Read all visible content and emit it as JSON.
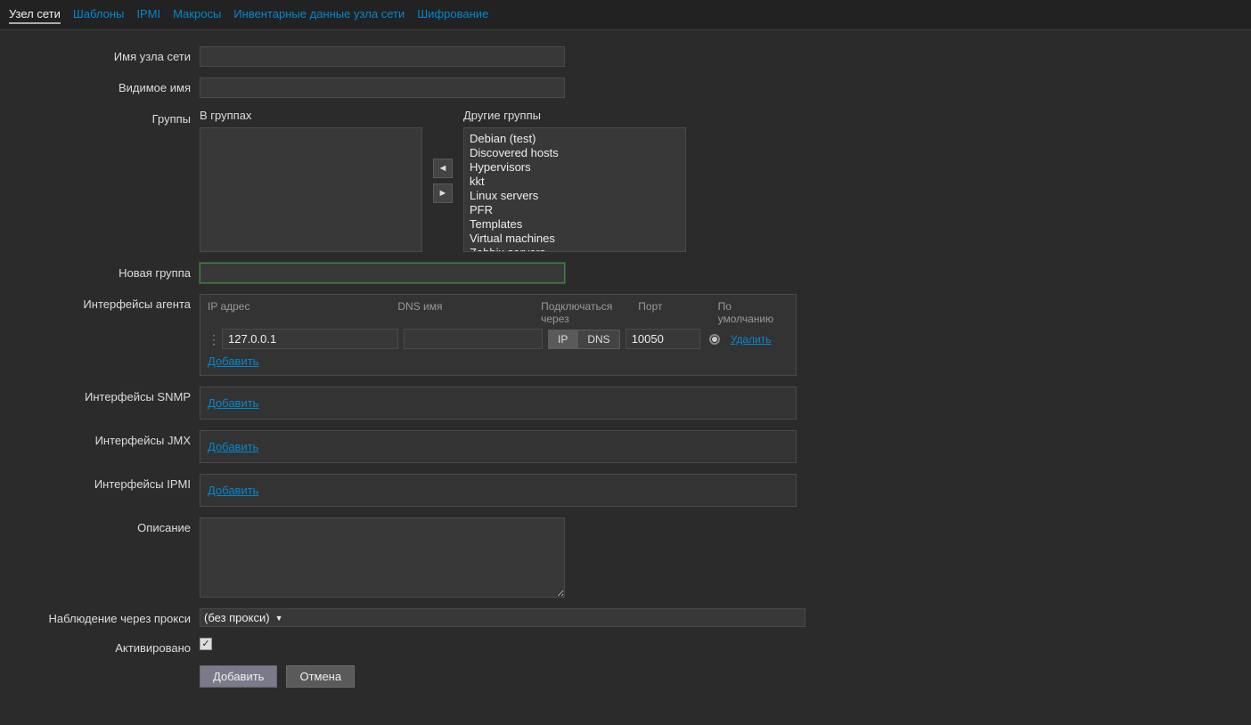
{
  "tabs": [
    "Узел сети",
    "Шаблоны",
    "IPMI",
    "Макросы",
    "Инвентарные данные узла сети",
    "Шифрование"
  ],
  "labels": {
    "hostname": "Имя узла сети",
    "visiblename": "Видимое имя",
    "groups": "Группы",
    "in_groups": "В группах",
    "other_groups": "Другие группы",
    "new_group": "Новая группа",
    "agent_ifaces": "Интерфейсы агента",
    "snmp_ifaces": "Интерфейсы SNMP",
    "jmx_ifaces": "Интерфейсы JMX",
    "ipmi_ifaces": "Интерфейсы IPMI",
    "description": "Описание",
    "proxy": "Наблюдение через прокси",
    "enabled": "Активировано"
  },
  "other_groups": [
    "Debian (test)",
    "Discovered hosts",
    "Hypervisors",
    "kkt",
    "Linux servers",
    "PFR",
    "Templates",
    "Virtual machines",
    "Zabbix servers"
  ],
  "iface_headers": {
    "ip": "IP адрес",
    "dns": "DNS имя",
    "connect": "Подключаться через",
    "port": "Порт",
    "default": "По умолчанию"
  },
  "agent_row": {
    "ip": "127.0.0.1",
    "dns": "",
    "conn_ip": "IP",
    "conn_dns": "DNS",
    "port": "10050"
  },
  "actions": {
    "add": "Добавить",
    "delete": "Удалить",
    "cancel": "Отмена"
  },
  "proxy_value": "(без прокси)",
  "icons": {
    "left": "◄",
    "right": "►",
    "caret": "▼",
    "drag": "⋮⋮"
  }
}
